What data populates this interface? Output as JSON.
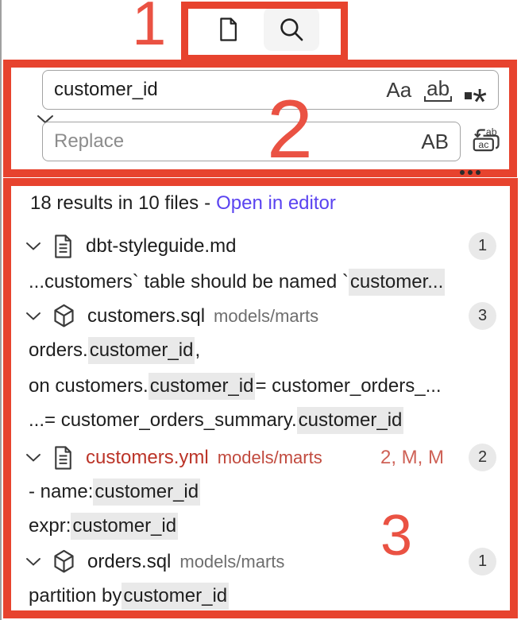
{
  "annotations": {
    "color": "#e7432e",
    "labels": {
      "one": "1",
      "two": "2",
      "three": "3"
    }
  },
  "toolbar": {
    "tabs": [
      {
        "name": "files",
        "icon": "file-icon",
        "active": false
      },
      {
        "name": "search",
        "icon": "search-icon",
        "active": true
      }
    ]
  },
  "search": {
    "query": "customer_id",
    "replace_placeholder": "Replace",
    "match_case_label": "Aa",
    "whole_word_label": "ab",
    "regex_label": "*",
    "preserve_case_label": "AB"
  },
  "results": {
    "summary": "18 results in 10 files",
    "separator": "-",
    "open_in_editor": "Open in editor",
    "files": [
      {
        "name": "dbt-styleguide.md",
        "icon": "doc",
        "path": "",
        "badge": "1",
        "error": false,
        "decoration": "",
        "matches": [
          [
            {
              "t": "...customers` table should be named `"
            },
            {
              "t": "customer...",
              "h": true
            }
          ]
        ]
      },
      {
        "name": "customers.sql",
        "icon": "cube",
        "path": "models/marts",
        "badge": "3",
        "error": false,
        "decoration": "",
        "matches": [
          [
            {
              "t": "orders."
            },
            {
              "t": "customer_id",
              "h": true
            },
            {
              "t": ","
            }
          ],
          [
            {
              "t": "on customers."
            },
            {
              "t": "customer_id",
              "h": true
            },
            {
              "t": " = customer_orders_..."
            }
          ],
          [
            {
              "t": "...= customer_orders_summary."
            },
            {
              "t": "customer_id",
              "h": true
            }
          ]
        ]
      },
      {
        "name": "customers.yml",
        "icon": "doc",
        "path": "models/marts",
        "badge": "2",
        "error": true,
        "decoration": "2, M, M",
        "matches": [
          [
            {
              "t": "- name: "
            },
            {
              "t": "customer_id",
              "h": true
            }
          ],
          [
            {
              "t": "expr: "
            },
            {
              "t": "customer_id",
              "h": true
            }
          ]
        ]
      },
      {
        "name": "orders.sql",
        "icon": "cube",
        "path": "models/marts",
        "badge": "1",
        "error": false,
        "decoration": "",
        "matches": [
          [
            {
              "t": "partition by "
            },
            {
              "t": "customer_id",
              "h": true
            }
          ]
        ]
      }
    ]
  },
  "colors": {
    "annotation_red": "#e7432e",
    "link_purple": "#5a43f0",
    "match_highlight": "#e9e9e9",
    "error_file_red": "#bb3428",
    "badge_bg": "#e9e9e9"
  }
}
